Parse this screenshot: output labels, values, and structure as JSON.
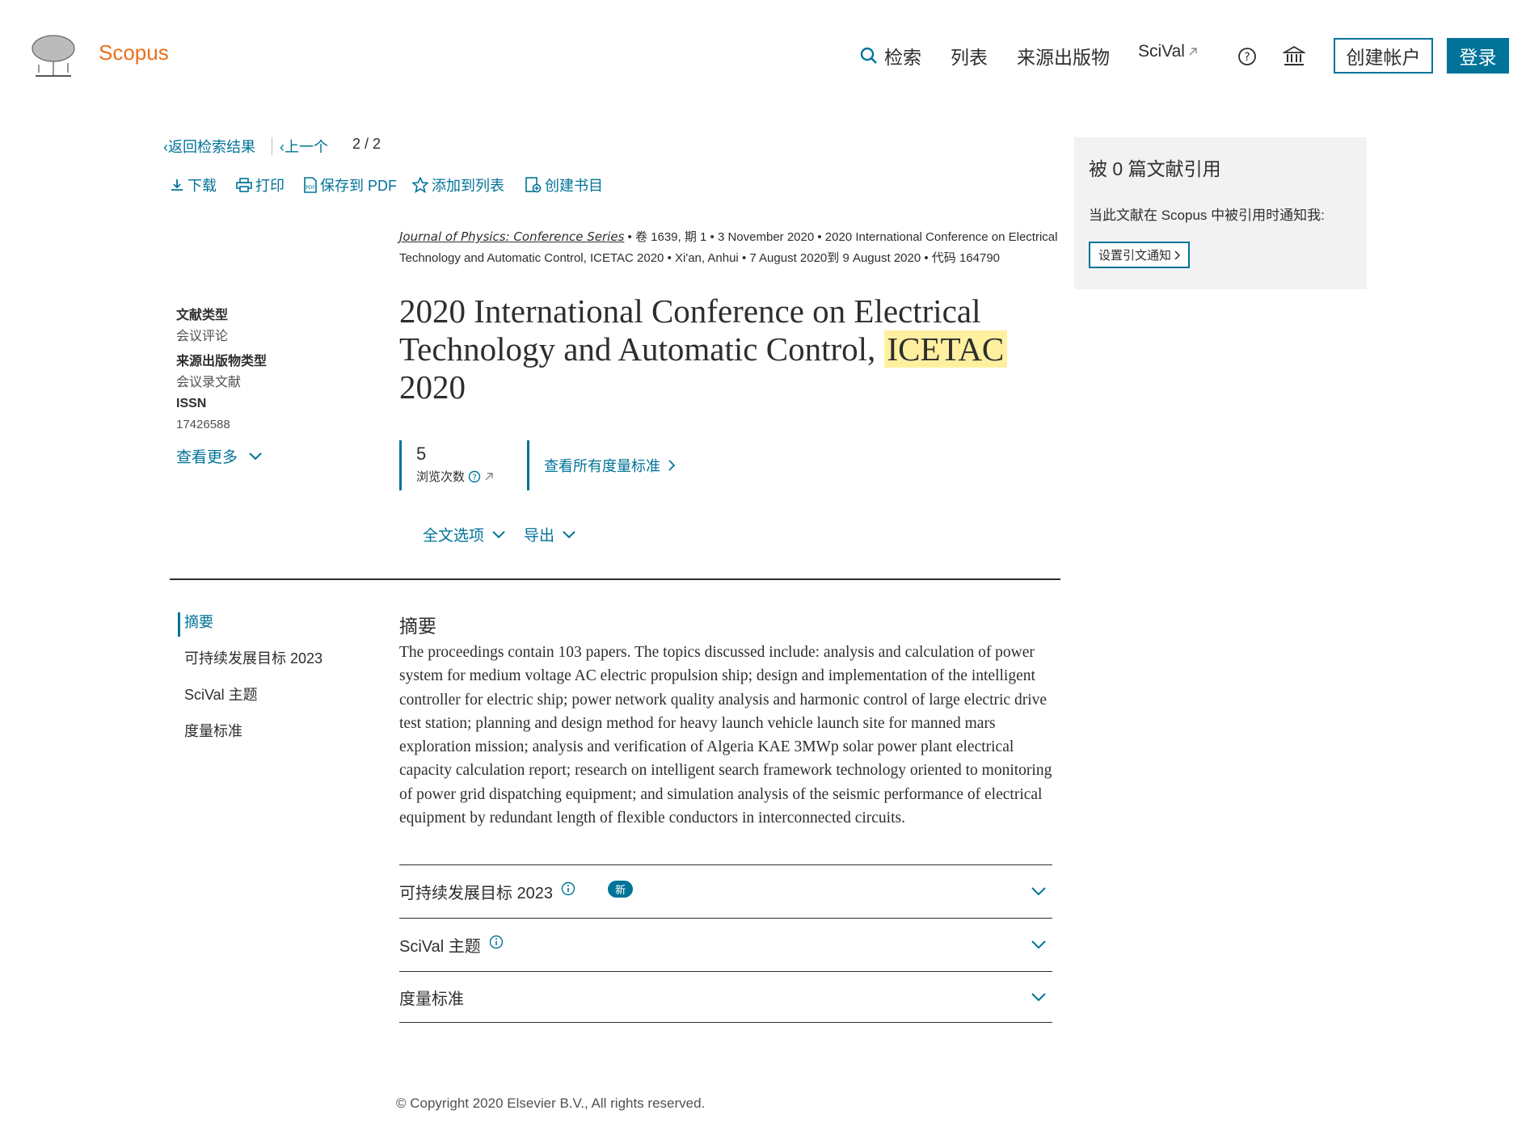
{
  "header": {
    "logo_text": "Scopus",
    "nav": {
      "search": "检索",
      "lists": "列表",
      "sources": "来源出版物",
      "scival": "SciVal"
    },
    "create_account": "创建帐户",
    "login": "登录"
  },
  "breadcrumb": {
    "back": "返回检索结果",
    "prev": "上一个",
    "page": "2 / 2"
  },
  "toolbar": {
    "download": "下载",
    "print": "打印",
    "save_pdf": "保存到 PDF",
    "add_list": "添加到列表",
    "bibliography": "创建书目"
  },
  "meta": {
    "journal": "Journal of Physics: Conference Series",
    "volume": "卷 1639, 期 1",
    "date": "3 November 2020",
    "conference_part1": "2020 International Conference on Electrical",
    "conference_part2": "Technology and Automatic Control, ICETAC 2020",
    "location": "Xi'an, Anhui",
    "conf_dates": "7 August 2020到 9 August 2020",
    "code": "代码 164790"
  },
  "sidebar": {
    "doc_type_label": "文献类型",
    "doc_type_value": "会议评论",
    "source_type_label": "来源出版物类型",
    "source_type_value": "会议录文献",
    "issn_label": "ISSN",
    "issn_value": "17426588",
    "see_more": "查看更多"
  },
  "title": {
    "line1": "2020 International Conference on Electrical",
    "line2_prefix": "Technology and Automatic Control, ",
    "highlight": "ICETAC",
    "line3": "2020"
  },
  "metrics": {
    "views_count": "5",
    "views_label": "浏览次数",
    "view_all": "查看所有度量标准"
  },
  "actions": {
    "full_text": "全文选项",
    "export": "导出"
  },
  "left_nav": {
    "abstract": "摘要",
    "sdg": "可持续发展目标 2023",
    "scival_topic": "SciVal 主题",
    "metrics": "度量标准"
  },
  "abstract": {
    "heading": "摘要",
    "text": "The proceedings contain 103 papers. The topics discussed include: analysis and calculation of power system for medium voltage AC electric propulsion ship; design and implementation of the intelligent controller for electric ship; power network quality analysis and harmonic control of large electric drive test station; planning and design method for heavy launch vehicle launch site for manned mars exploration mission; analysis and verification of Algeria KAE 3MWp solar power plant electrical capacity calculation report; research on intelligent search framework technology oriented to monitoring of power grid dispatching equipment; and simulation analysis of the seismic performance of electrical equipment by redundant length of flexible conductors in interconnected circuits."
  },
  "sections": {
    "sdg": "可持续发展目标 2023",
    "sdg_badge": "新",
    "scival": "SciVal 主题",
    "metrics": "度量标准"
  },
  "cited_by": {
    "title": "被 0 篇文献引用",
    "notify_text": "当此文献在 Scopus 中被引用时通知我:",
    "button": "设置引文通知"
  },
  "footer": {
    "copyright": "© Copyright 2020 Elsevier B.V., All rights reserved."
  },
  "colors": {
    "accent": "#007398",
    "brand_orange": "#e9711c",
    "highlight": "#fff0a0"
  }
}
